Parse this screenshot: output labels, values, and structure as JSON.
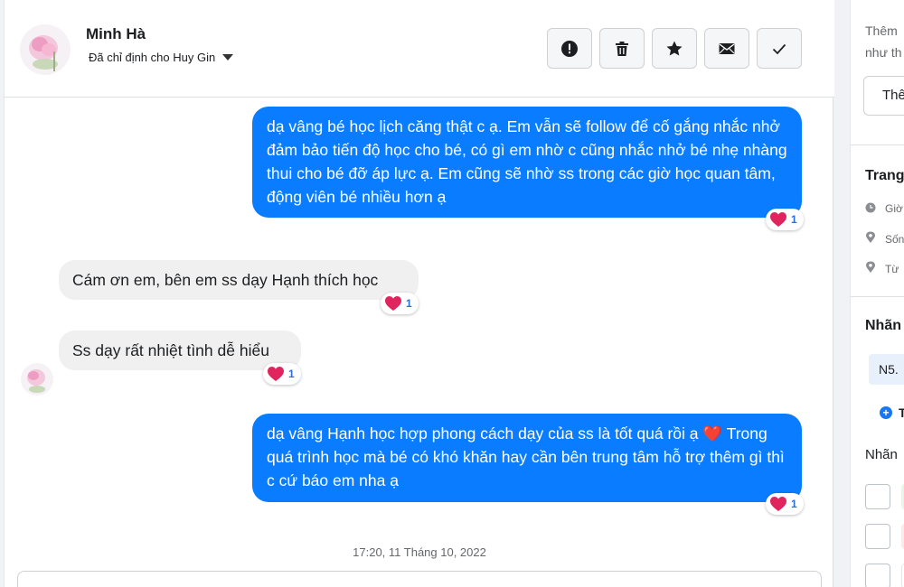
{
  "contact": {
    "name": "Minh Hà",
    "assigned_to": "Đã chỉ định cho Huy Gin"
  },
  "actions": [
    {
      "name": "report-icon",
      "label": "!"
    },
    {
      "name": "trash-icon",
      "label": ""
    },
    {
      "name": "star-icon",
      "label": ""
    },
    {
      "name": "mail-icon",
      "label": ""
    },
    {
      "name": "check-icon",
      "label": ""
    }
  ],
  "messages": [
    {
      "direction": "outgoing",
      "text": "dạ vâng bé học lịch căng thật c ạ. Em vẫn sẽ follow để cố gắng nhắc nhở đảm bảo tiến độ học cho bé, có gì em nhờ c cũng nhắc nhở bé nhẹ nhàng thui cho bé đỡ áp lực ạ. Em cũng sẽ nhờ ss trong các giờ học quan tâm, động viên bé nhiều hơn ạ",
      "reaction_count": "1"
    },
    {
      "direction": "incoming",
      "text": "Cám ơn em, bên em ss dạy Hạnh thích học",
      "reaction_count": "1"
    },
    {
      "direction": "incoming",
      "text": "Ss dạy rất nhiệt tình dễ hiểu",
      "reaction_count": "1"
    },
    {
      "direction": "outgoing",
      "text": "dạ vâng Hạnh học hợp phong cách dạy của ss là tốt quá rồi ạ ❤️ Trong quá trình học mà bé có khó khăn hay cần bên trung tâm hỗ trợ thêm gì thì c cứ báo em nha ạ",
      "reaction_count": "1"
    }
  ],
  "timestamp": "17:20, 11 Tháng 10, 2022",
  "sidebar": {
    "hint_line1": "Thêm",
    "hint_line2": "như th",
    "add_button": "Thê",
    "section_info": "Trang",
    "info_items": [
      "Giờ",
      "Sốn",
      "Từ"
    ],
    "section_labels": "Nhãn",
    "tag": "N5.",
    "add_tag": "T",
    "subsection": "Nhãn",
    "colors": {
      "chip1": "#e9f5e5",
      "chip2": "#fde9e7",
      "chip3": "#ffffff"
    }
  },
  "colors": {
    "outgoing_bubble": "#0a7cff",
    "incoming_bubble": "#f0f0f0",
    "heart": "#e0245e"
  }
}
